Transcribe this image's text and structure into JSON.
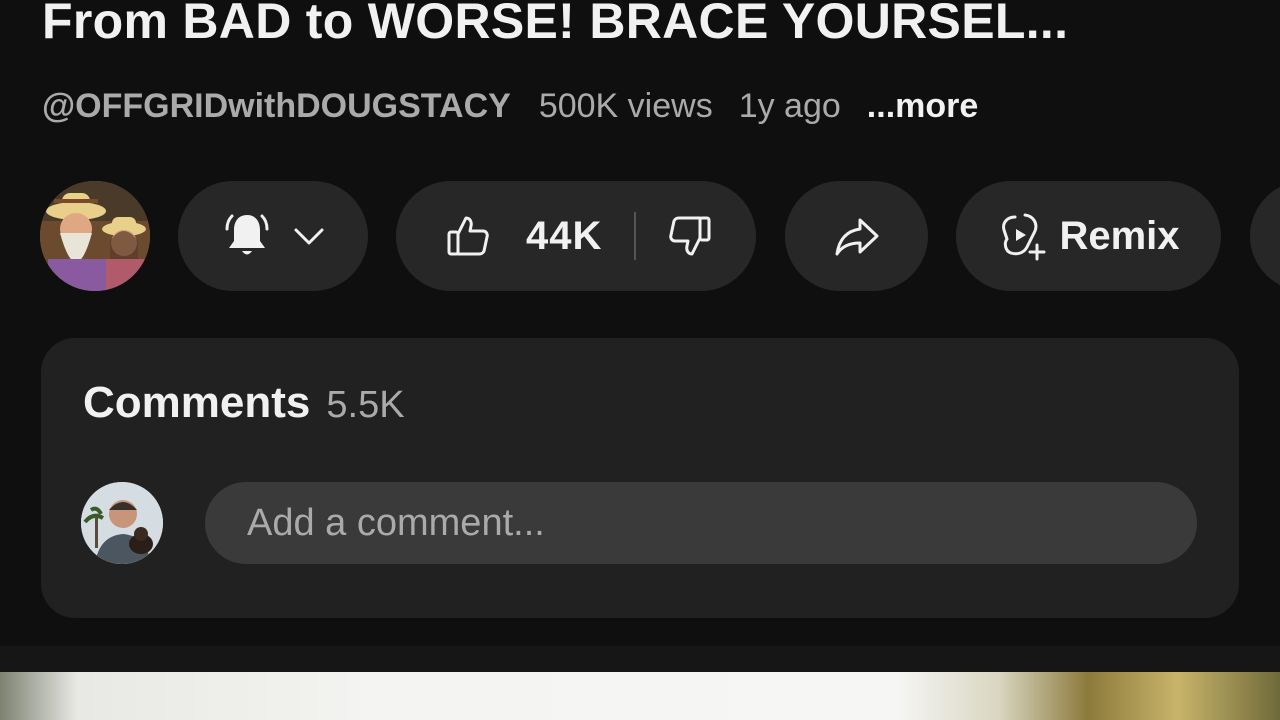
{
  "video": {
    "title": "From BAD to WORSE! BRACE YOURSEL...",
    "channel_handle": "@OFFGRIDwithDOUGSTACY",
    "views": "500K views",
    "age": "1y ago",
    "more_label": "...more"
  },
  "actions": {
    "subscribe_icon": "bell-icon",
    "like_count": "44K",
    "like_icon": "thumbs-up-icon",
    "dislike_icon": "thumbs-down-icon",
    "share_icon": "share-icon",
    "remix_label": "Remix",
    "remix_icon": "remix-icon"
  },
  "comments": {
    "title": "Comments",
    "count": "5.5K",
    "input_placeholder": "Add a comment..."
  },
  "colors": {
    "background": "#0f0f0f",
    "pill": "#272727",
    "card": "#212121",
    "secondary_text": "#aaaaaa"
  }
}
